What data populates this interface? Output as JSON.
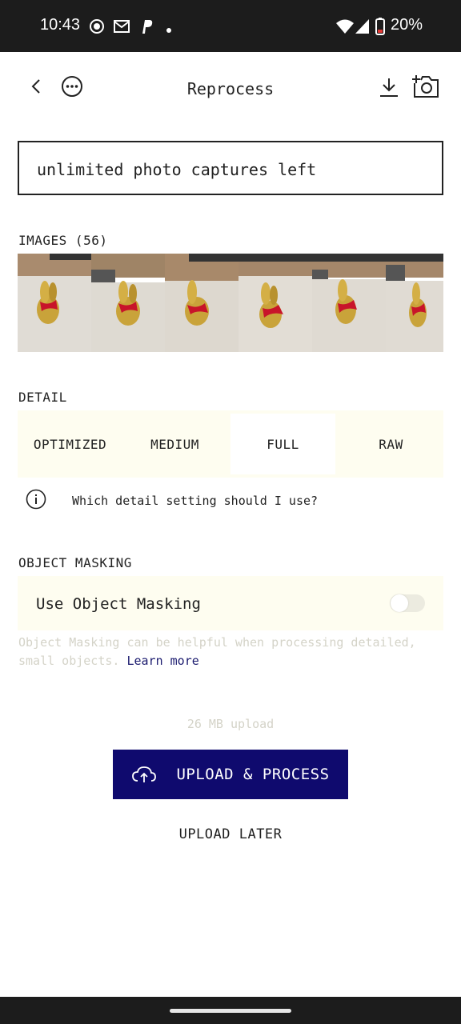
{
  "status_bar": {
    "time": "10:43",
    "battery": "20%",
    "icons": [
      "record-icon",
      "mail-icon",
      "paypal-icon",
      "dot-icon",
      "wifi-icon",
      "signal-icon",
      "battery-icon"
    ]
  },
  "header": {
    "title": "Reprocess",
    "back_icon": "chevron-left-icon",
    "more_icon": "more-horizontal-icon",
    "download_icon": "download-icon",
    "add_photo_icon": "add-camera-icon"
  },
  "captures": {
    "text": "unlimited photo captures left"
  },
  "images": {
    "label": "IMAGES (56)"
  },
  "detail": {
    "label": "DETAIL",
    "options": [
      "OPTIMIZED",
      "MEDIUM",
      "FULL",
      "RAW"
    ],
    "selected": "FULL",
    "help_text": "Which detail setting should I use?"
  },
  "masking": {
    "label": "OBJECT MASKING",
    "toggle_label": "Use Object Masking",
    "enabled": false,
    "description": "Object Masking can be helpful when processing detailed, small objects.",
    "learn_more": "Learn more"
  },
  "upload": {
    "size_text": "26 MB upload",
    "primary_label": "UPLOAD & PROCESS",
    "secondary_label": "UPLOAD LATER"
  },
  "colors": {
    "primary": "#0f0a6e",
    "panel_bg": "#fefdf0",
    "status_bar": "#1c1c1c"
  }
}
